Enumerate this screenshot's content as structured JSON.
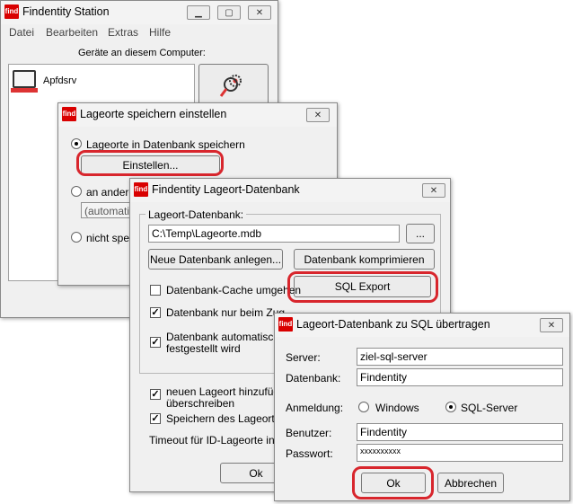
{
  "main_window": {
    "logo": "find",
    "title": "Findentity Station",
    "menu": [
      "Datei",
      "Bearbeiten",
      "Extras",
      "Hilfe"
    ],
    "devices_label": "Geräte an diesem Computer:",
    "device_name": "Apfdsrv"
  },
  "lageorte_dialog": {
    "logo": "find",
    "title": "Lageorte speichern einstellen",
    "option_db": "Lageorte in Datenbank speichern",
    "settings_button": "Einstellen...",
    "option_other": "an andere",
    "other_field": "(automatisc",
    "option_none": "nicht spei"
  },
  "db_dialog": {
    "logo": "find",
    "title": "Findentity Lageort-Datenbank",
    "group_label": "Lageort-Datenbank:",
    "path": "C:\\Temp\\Lageorte.mdb",
    "browse_button": "...",
    "new_db_button": "Neue Datenbank anlegen...",
    "compress_button": "Datenbank komprimieren",
    "sql_export_button": "SQL Export",
    "chk_cache": "Datenbank-Cache umgehen",
    "chk_access": "Datenbank nur beim Zugriff öffnen, danach wieder schließen",
    "chk_auto_1": "Datenbank automatisch r",
    "chk_auto_2": "festgestellt wird",
    "chk_new_1": "neuen Lageort hinzufüge",
    "chk_new_2": "überschreiben",
    "chk_save": "Speichern des Lageortes",
    "timeout_label": "Timeout für ID-Lageorte in S",
    "ok_button": "Ok"
  },
  "sql_dialog": {
    "logo": "find",
    "title": "Lageort-Datenbank zu SQL übertragen",
    "server_label": "Server:",
    "server_value": "ziel-sql-server",
    "database_label": "Datenbank:",
    "database_value": "Findentity",
    "login_label": "Anmeldung:",
    "login_windows": "Windows",
    "login_sql": "SQL-Server",
    "user_label": "Benutzer:",
    "user_value": "Findentity",
    "password_label": "Passwort:",
    "password_value": "xxxxxxxxxx",
    "ok_button": "Ok",
    "cancel_button": "Abbrechen"
  },
  "colors": {
    "highlight": "#d8262d",
    "logo": "#d90000"
  }
}
